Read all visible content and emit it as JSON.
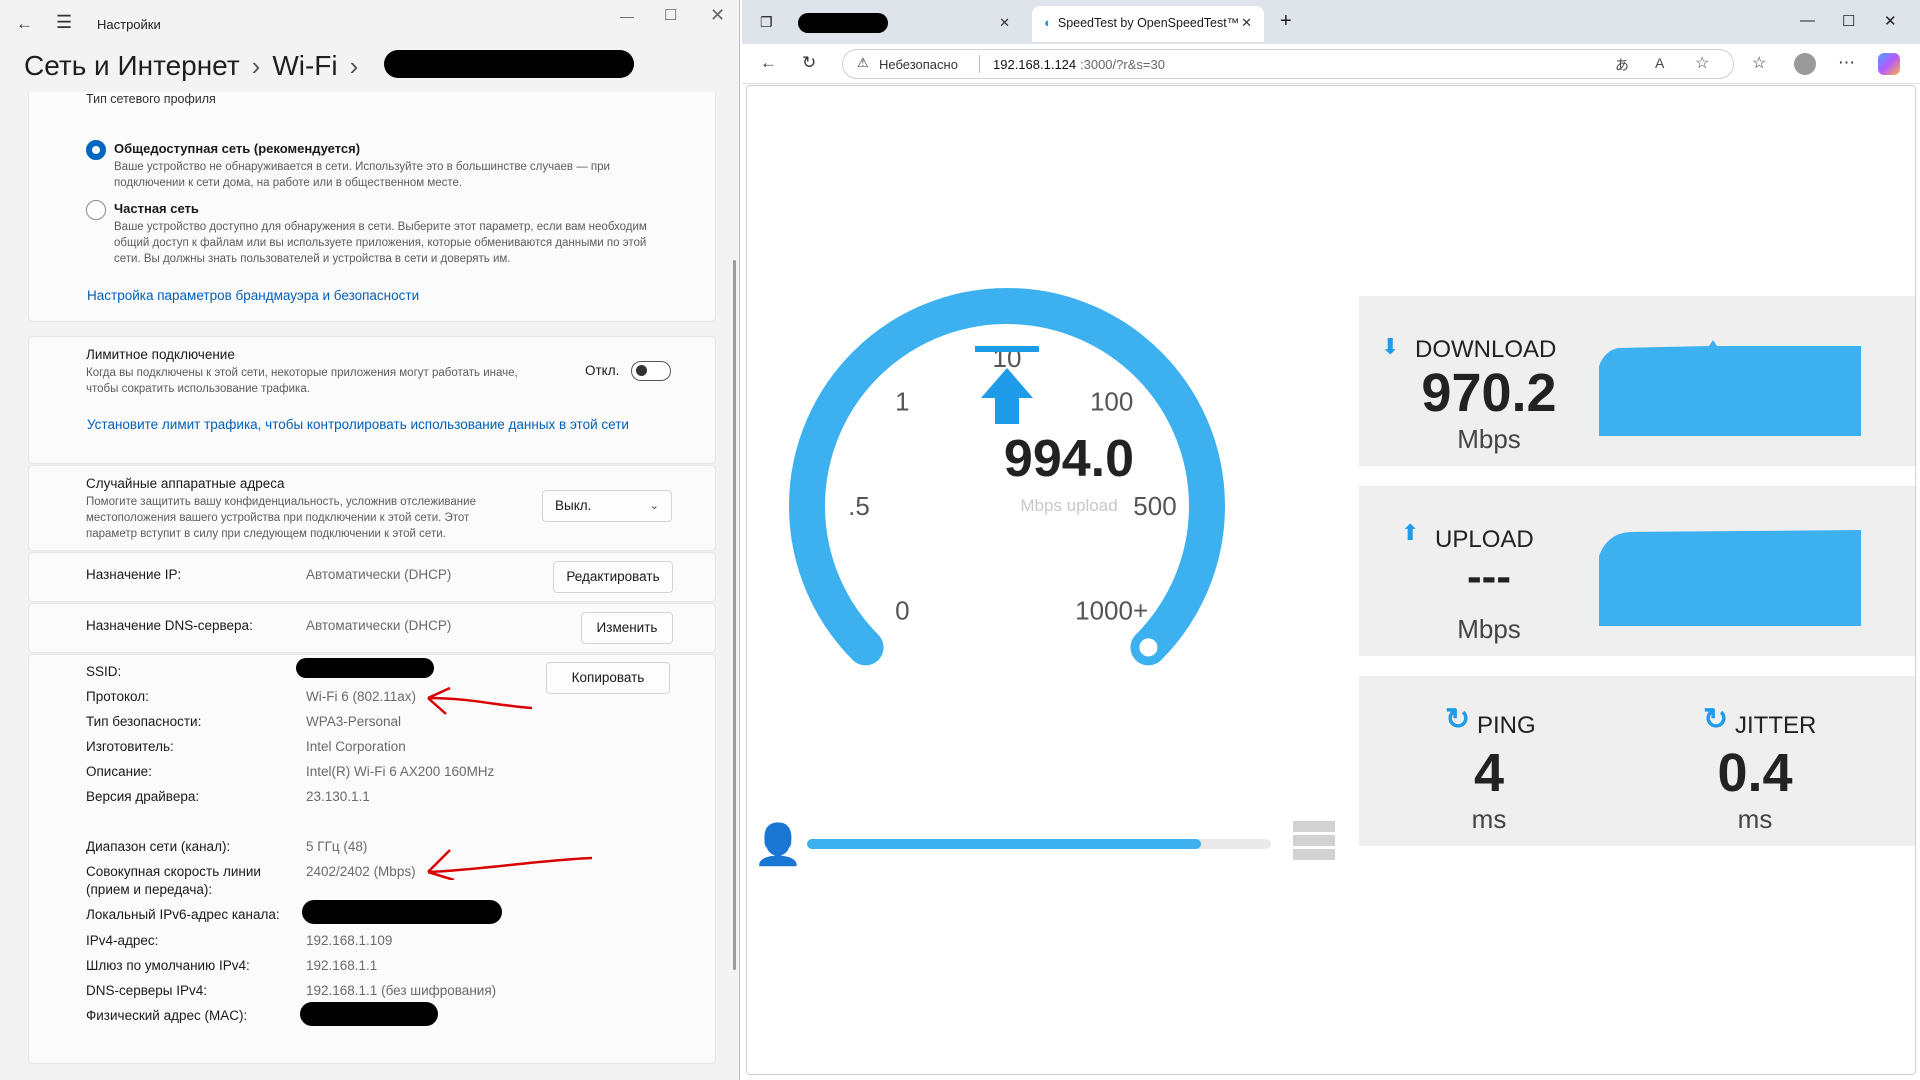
{
  "settings": {
    "window_title": "Настройки",
    "breadcrumb": {
      "root": "Сеть и Интернет",
      "sep": "›",
      "page": "Wi-Fi"
    },
    "profile": {
      "heading": "Тип сетевого профиля",
      "public_label": "Общедоступная сеть (рекомендуется)",
      "public_desc_1": "Ваше устройство не обнаруживается в сети. Используйте это в большинстве случаев — при",
      "public_desc_2": "подключении к сети дома, на работе или в общественном месте.",
      "private_label": "Частная сеть",
      "private_desc_1": "Ваше устройство доступно для обнаружения в сети. Выберите этот параметр, если вам необходим",
      "private_desc_2": "общий доступ к файлам или вы используете приложения, которые обмениваются данными по этой",
      "private_desc_3": "сети. Вы должны знать пользователей и устройства в сети и доверять им.",
      "firewall_link": "Настройка параметров брандмауэра и безопасности"
    },
    "metered": {
      "title": "Лимитное подключение",
      "desc_1": "Когда вы подключены к этой сети, некоторые приложения могут работать иначе,",
      "desc_2": "чтобы сократить использование трафика.",
      "state": "Откл.",
      "link": "Установите лимит трафика, чтобы контролировать использование данных в этой сети"
    },
    "random_mac": {
      "title": "Случайные аппаратные адреса",
      "desc_1": "Помогите защитить вашу конфиденциальность, усложнив отслеживание",
      "desc_2": "местоположения вашего устройства при подключении к этой сети. Этот",
      "desc_3": "параметр вступит в силу при следующем подключении к этой сети.",
      "value": "Выкл."
    },
    "ip": {
      "label": "Назначение IP:",
      "value": "Автоматически (DHCP)",
      "button": "Редактировать"
    },
    "dns": {
      "label": "Назначение DNS-сервера:",
      "value": "Автоматически (DHCP)",
      "button": "Изменить"
    },
    "props": {
      "copy_button": "Копировать",
      "ssid_label": "SSID:",
      "protocol_label": "Протокол:",
      "protocol": "Wi-Fi 6 (802.11ax)",
      "security_label": "Тип безопасности:",
      "security": "WPA3-Personal",
      "vendor_label": "Изготовитель:",
      "vendor": "Intel Corporation",
      "desc_label": "Описание:",
      "desc": "Intel(R) Wi-Fi 6 AX200 160MHz",
      "driver_label": "Версия драйвера:",
      "driver": "23.130.1.1",
      "band_label": "Диапазон сети (канал):",
      "band": "5 ГГц (48)",
      "speed_label_1": "Совокупная скорость линии",
      "speed_label_2": "(прием и передача):",
      "speed": "2402/2402 (Mbps)",
      "ipv6_label": "Локальный IPv6-адрес канала:",
      "ipv4_label": "IPv4-адрес:",
      "ipv4": "192.168.1.109",
      "gateway_label": "Шлюз по умолчанию IPv4:",
      "gateway": "192.168.1.1",
      "dns4_label": "DNS-серверы IPv4:",
      "dns4": "192.168.1.1 (без шифрования)",
      "mac_label": "Физический адрес (MAC):"
    }
  },
  "browser": {
    "tab_title": "SpeedTest by OpenSpeedTest™",
    "security": "Небезопасно",
    "url_host": "192.168.1.124",
    "url_rest": ":3000/?r&s=30"
  },
  "speedtest": {
    "gauge": {
      "value": "994.0",
      "unit": "Mbps upload",
      "ticks": [
        "0",
        ".5",
        "1",
        "10",
        "100",
        "500",
        "1000+"
      ],
      "progress": 0.85
    },
    "download": {
      "label": "DOWNLOAD",
      "value": "970.2",
      "unit": "Mbps"
    },
    "upload": {
      "label": "UPLOAD",
      "value": "---",
      "unit": "Mbps"
    },
    "ping": {
      "label": "PING",
      "value": "4",
      "unit": "ms"
    },
    "jitter": {
      "label": "JITTER",
      "value": "0.4",
      "unit": "ms"
    },
    "colors": {
      "accent": "#3db0f0",
      "arrow": "#1e9be9",
      "panel": "#efefef"
    }
  }
}
